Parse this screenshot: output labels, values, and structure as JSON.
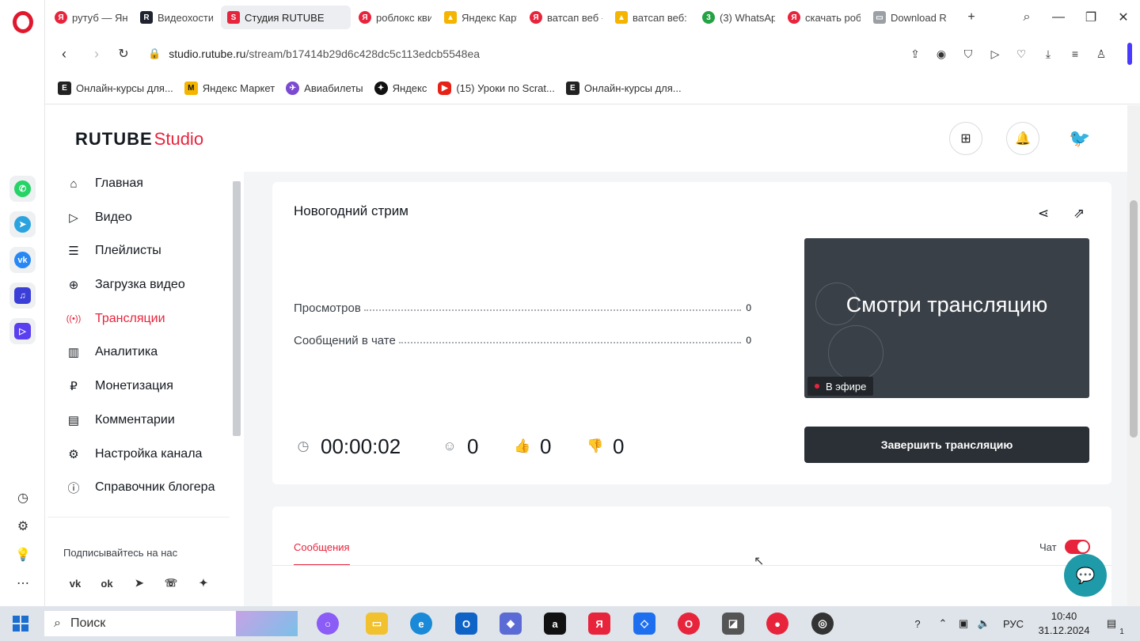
{
  "browser": {
    "tabs": [
      {
        "label": "рутуб — Янд",
        "fav": "Я",
        "color": "#e8243c"
      },
      {
        "label": "Видеохостин",
        "fav": "R",
        "color": "#1f2330"
      },
      {
        "label": "Студия RUTUBE",
        "fav": "S",
        "color": "#e8243c"
      },
      {
        "label": "роблокс кви",
        "fav": "Я",
        "color": "#e8243c"
      },
      {
        "label": "Яндекс Карт",
        "fav": "▲",
        "color": "#f4b400"
      },
      {
        "label": "ватсап веб -",
        "fav": "Я",
        "color": "#e8243c"
      },
      {
        "label": "ватсап веб:",
        "fav": "▲",
        "color": "#f4b400"
      },
      {
        "label": "(3) WhatsAp",
        "fav": "3",
        "color": "#25a244"
      },
      {
        "label": "скачать роб",
        "fav": "Я",
        "color": "#e8243c"
      },
      {
        "label": "Download R",
        "fav": "▭",
        "color": "#9aa0a6"
      }
    ],
    "url_host": "studio.rutube.ru",
    "url_path": "/stream/b17414b29d6c428dc5c113edcb5548ea",
    "bookmarks": [
      {
        "label": "Онлайн-курсы для...",
        "fav": "E",
        "color": "#222222"
      },
      {
        "label": "Яндекс Маркет",
        "fav": "M",
        "color": "#f4b400"
      },
      {
        "label": "Авиабилеты",
        "fav": "✈",
        "color": "#7b4ad0"
      },
      {
        "label": "Яндекс",
        "fav": "✦",
        "color": "#111111"
      },
      {
        "label": "(15) Уроки по Scrat...",
        "fav": "▶",
        "color": "#e62117"
      },
      {
        "label": "Онлайн-курсы для...",
        "fav": "E",
        "color": "#222222"
      }
    ]
  },
  "studio": {
    "logo_main": "RUTUBE",
    "logo_sub": "Studio",
    "nav": [
      {
        "label": "Главная",
        "icon": "⌂",
        "name": "home"
      },
      {
        "label": "Видео",
        "icon": "▷",
        "name": "video"
      },
      {
        "label": "Плейлисты",
        "icon": "☰",
        "name": "playlists"
      },
      {
        "label": "Загрузка видео",
        "icon": "⊕",
        "name": "upload"
      },
      {
        "label": "Трансляции",
        "icon": "((•))",
        "name": "streams"
      },
      {
        "label": "Аналитика",
        "icon": "▥",
        "name": "analytics"
      },
      {
        "label": "Монетизация",
        "icon": "₽",
        "name": "monetization"
      },
      {
        "label": "Комментарии",
        "icon": "▤",
        "name": "comments"
      },
      {
        "label": "Настройка канала",
        "icon": "⚙",
        "name": "channel-settings"
      },
      {
        "label": "Справочник блогера",
        "icon": "ⓘ",
        "name": "blogger-guide"
      }
    ],
    "active_nav": "Трансляции",
    "follow_title": "Подписывайтесь на нас",
    "socials": [
      "vk",
      "ok",
      "telegram",
      "viber",
      "zen"
    ],
    "stream": {
      "title": "Новогодний стрим",
      "stats": [
        {
          "label": "Просмотров",
          "value": "0"
        },
        {
          "label": "Сообщений в чате",
          "value": "0"
        }
      ],
      "duration": "00:00:02",
      "viewers": "0",
      "likes": "0",
      "dislikes": "0",
      "preview_text": "Смотри трансляцию",
      "live_label": "В эфире",
      "end_button": "Завершить трансляцию"
    },
    "chat": {
      "tab_label": "Сообщения",
      "toggle_label": "Чат",
      "toggle_on": true
    }
  },
  "taskbar": {
    "search_label": "Поиск",
    "lang": "РУС",
    "time": "10:40",
    "date": "31.12.2024",
    "notification_count": "1"
  },
  "colors": {
    "accent": "#e8243c",
    "dark_button": "#2b3036",
    "support": "#1e9aa8"
  }
}
